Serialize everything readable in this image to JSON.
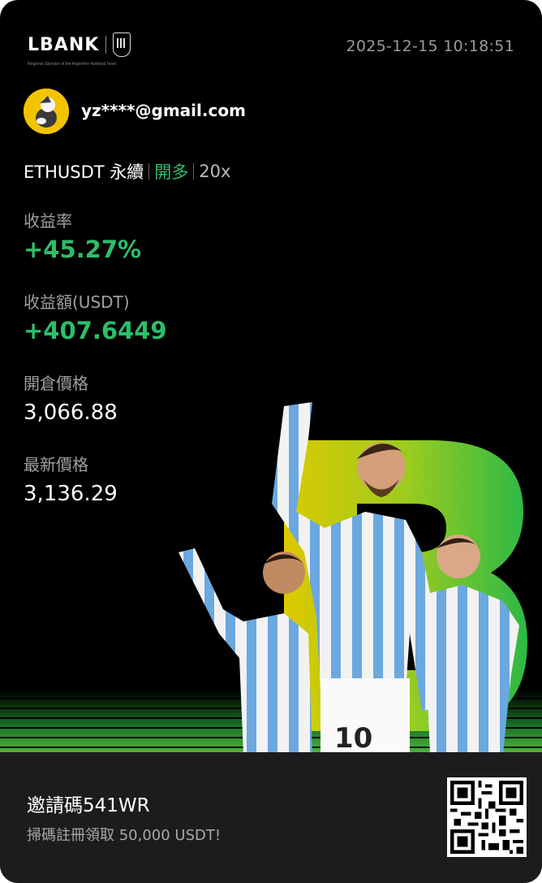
{
  "brand": {
    "logo_text": "LBANK",
    "tagline": "Regional Sponsor of the Argentine National Team"
  },
  "timestamp": "2025-12-15 10:18:51",
  "user": {
    "email": "yz****@gmail.com"
  },
  "position": {
    "pair": "ETHUSDT 永續",
    "side": "開多",
    "leverage": "20x"
  },
  "stats": {
    "roi_label": "收益率",
    "roi_value": "+45.27%",
    "pnl_label": "收益額(USDT)",
    "pnl_value": "+407.6449",
    "entry_label": "開倉價格",
    "entry_value": "3,066.88",
    "last_label": "最新價格",
    "last_value": "3,136.29"
  },
  "footer": {
    "invite_code": "邀請碼541WR",
    "promo": "掃碼註冊領取 50,000 USDT!"
  },
  "colors": {
    "positive": "#2ebd6a",
    "background": "#000000",
    "footer_bg": "#1c1c1e",
    "hero_letter": "#6be04a"
  },
  "hero_image": {
    "icon": "football-players-image",
    "jersey_number": "10"
  }
}
